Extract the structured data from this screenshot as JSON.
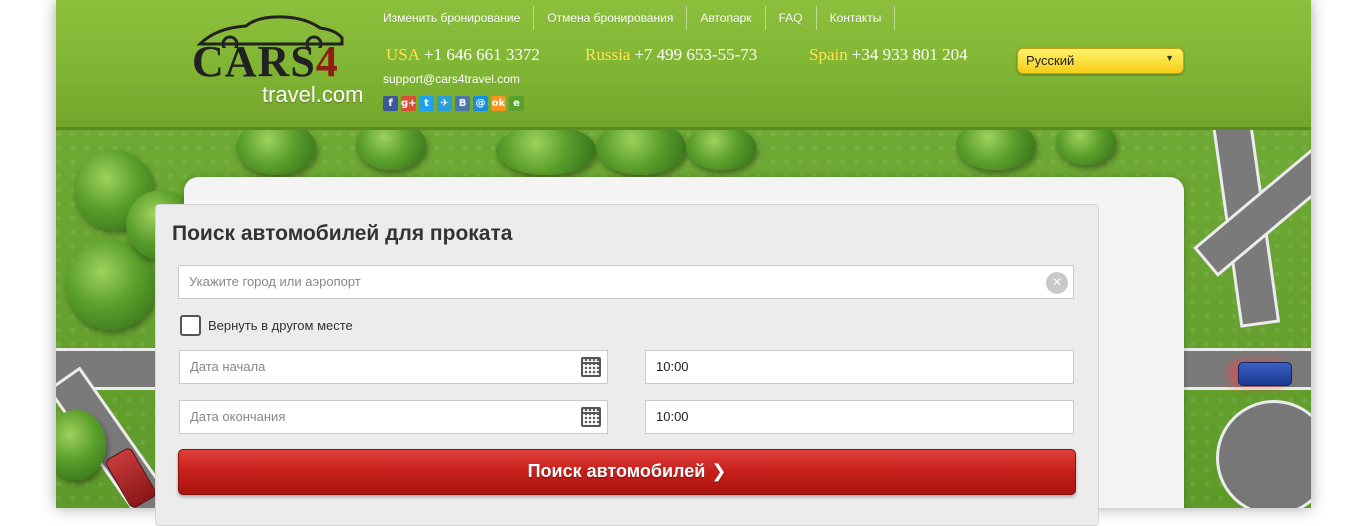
{
  "logo": {
    "brand": "CARS",
    "brand_num": "4",
    "sub": "travel.com"
  },
  "nav": [
    {
      "label": "Изменить бронирование"
    },
    {
      "label": "Отмена бронирования"
    },
    {
      "label": "Автопарк"
    },
    {
      "label": "FAQ"
    },
    {
      "label": "Контакты"
    }
  ],
  "phones": [
    {
      "country": "USA",
      "number": "+1 646 661 3372"
    },
    {
      "country": "Russia",
      "number": "+7 499 653-55-73"
    },
    {
      "country": "Spain",
      "number": "+34 933 801 204"
    }
  ],
  "email": "support@cars4travel.com",
  "socials": [
    {
      "icon": "facebook-icon",
      "glyph": "f",
      "color": "#3b5998"
    },
    {
      "icon": "google-plus-icon",
      "glyph": "g+",
      "color": "#dd4b39"
    },
    {
      "icon": "twitter-icon",
      "glyph": "t",
      "color": "#1da1f2"
    },
    {
      "icon": "plane-icon",
      "glyph": "✈",
      "color": "#2a9fd6"
    },
    {
      "icon": "vk-icon",
      "glyph": "B",
      "color": "#4a76a8"
    },
    {
      "icon": "mailru-icon",
      "glyph": "@",
      "color": "#168de2"
    },
    {
      "icon": "odnoklassniki-icon",
      "glyph": "ok",
      "color": "#f7931e"
    },
    {
      "icon": "evernote-icon",
      "glyph": "e",
      "color": "#5aa02c"
    }
  ],
  "language": {
    "selected": "Русский"
  },
  "search": {
    "title": "Поиск автомобилей для проката",
    "city_placeholder": "Укажите город или аэропорт",
    "return_label": "Вернуть в другом месте",
    "start_placeholder": "Дата начала",
    "start_time": "10:00",
    "end_placeholder": "Дата окончания",
    "end_time": "10:00",
    "button_label": "Поиск автомобилей"
  },
  "colors": {
    "header_green": "#7fb333",
    "phone_country": "#ffe34d",
    "button_red": "#c61f1a",
    "lang_yellow": "#f6cd17"
  }
}
